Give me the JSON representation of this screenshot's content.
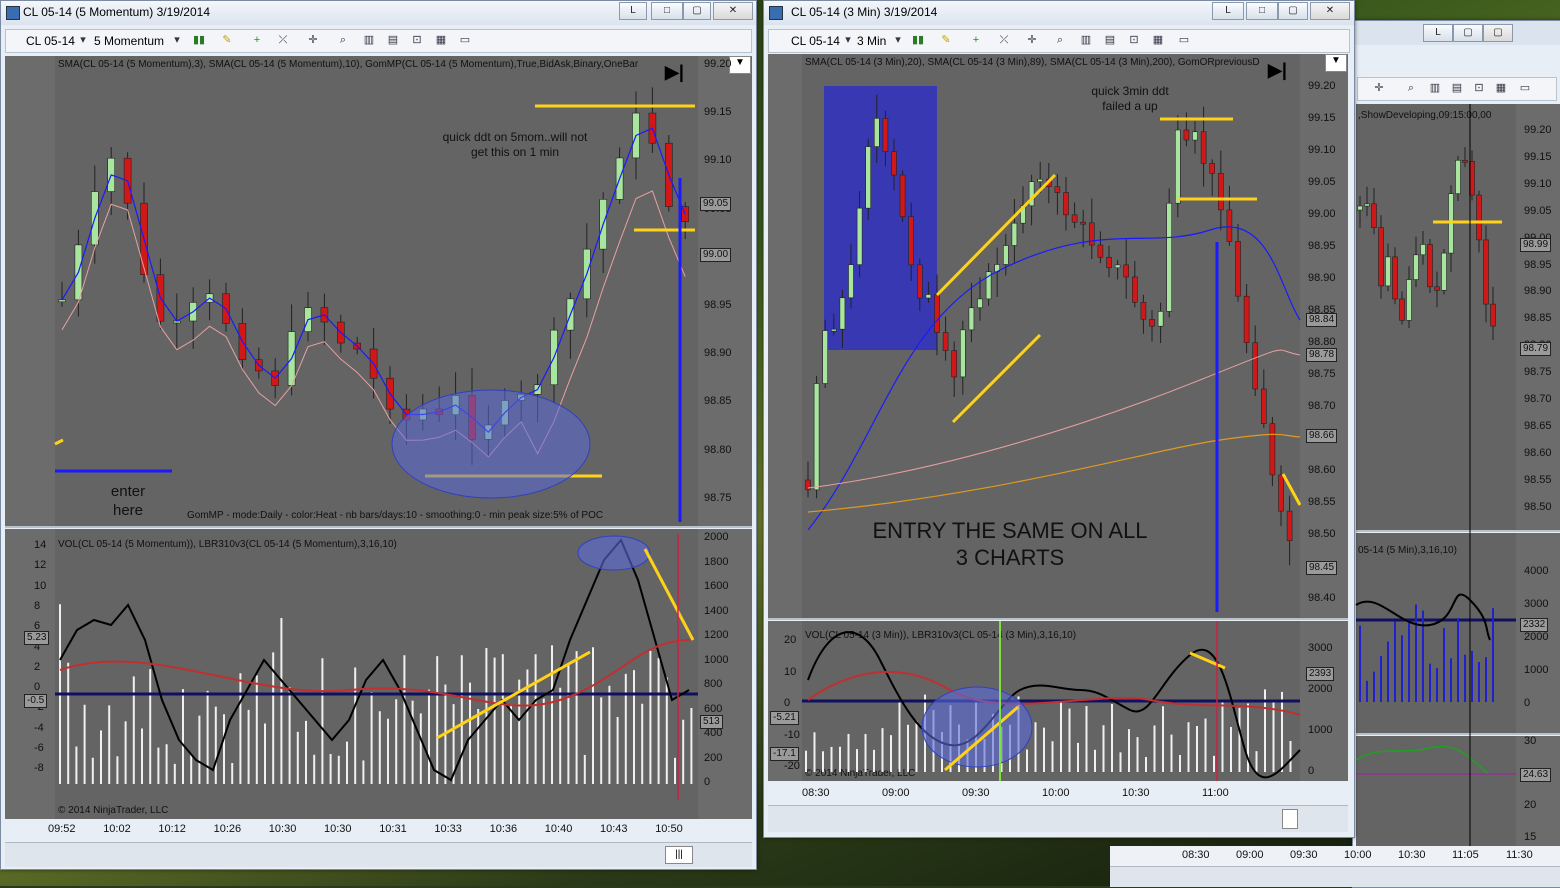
{
  "win1": {
    "title": "CL 05-14 (5 Momentum)  3/19/2014",
    "toolbar": {
      "instrument": "CL 05-14",
      "interval": "5 Momentum"
    },
    "indicators_label": "SMA(CL 05-14 (5 Momentum),3), SMA(CL 05-14 (5 Momentum),10), GomMP(CL 05-14 (5 Momentum),True,BidAsk,Binary,OneBar",
    "gom_label": "GomMP - mode:Daily  - color:Heat - nb bars/days:10 - smoothing:0 - min peak size:5% of POC",
    "lower_label": "VOL(CL 05-14 (5 Momentum)), LBR310v3(CL 05-14 (5 Momentum),3,16,10)",
    "copyright": "© 2014 NinjaTrader, LLC",
    "annotation_1": "quick ddt on 5mom..will not",
    "annotation_2": "get this on 1 min",
    "enter_1": "enter",
    "enter_2": "here",
    "price_ticks": [
      "99.20",
      "99.15",
      "99.10",
      "99.05",
      "99.00",
      "98.95",
      "98.90",
      "98.85",
      "98.80",
      "98.75"
    ],
    "price_box_1": "99.05",
    "price_box_2": "99.00",
    "osc_ticks": [
      "14",
      "12",
      "10",
      "8",
      "6",
      "4",
      "2",
      "0",
      "-2",
      "-4",
      "-6",
      "-8"
    ],
    "osc_box_1": "5.23",
    "osc_box_2": "-0.5",
    "vol_ticks": [
      "2000",
      "1800",
      "1600",
      "1400",
      "1200",
      "1000",
      "800",
      "600",
      "400",
      "200",
      "0"
    ],
    "vol_box": "513",
    "vol_bottom": "0",
    "time_ticks": [
      "09:52",
      "10:02",
      "10:12",
      "10:26",
      "10:30",
      "10:30",
      "10:31",
      "10:33",
      "10:36",
      "10:40",
      "10:43",
      "10:50"
    ]
  },
  "win2": {
    "title": "CL 05-14 (3 Min)  3/19/2014",
    "toolbar": {
      "instrument": "CL 05-14",
      "interval": "3 Min"
    },
    "indicators_label": "SMA(CL 05-14 (3 Min),20), SMA(CL 05-14 (3 Min),89), SMA(CL 05-14 (3 Min),200), GomORpreviousD",
    "lower_label": "VOL(CL 05-14 (3 Min)), LBR310v3(CL 05-14 (3 Min),3,16,10)",
    "copyright": "© 2014 NinjaTrader, LLC",
    "annotation_1": "quick 3min ddt",
    "annotation_2": "failed a up",
    "entry_1": "ENTRY THE SAME ON ALL",
    "entry_2": "3 CHARTS",
    "price_ticks": [
      "99.20",
      "99.15",
      "99.10",
      "99.05",
      "99.00",
      "98.95",
      "98.90",
      "98.85",
      "98.80",
      "98.75",
      "98.70",
      "98.65",
      "98.60",
      "98.55",
      "98.50",
      "98.45",
      "98.40"
    ],
    "price_box_1": "98.84",
    "price_box_2": "98.78",
    "price_box_3": "98.66",
    "price_box_4": "98.45",
    "osc_ticks": [
      "20",
      "10",
      "0",
      "-10",
      "-20"
    ],
    "osc_box_1": "-5.21",
    "osc_box_2": "-17.1",
    "vol_ticks": [
      "3000",
      "2000",
      "1000",
      "0"
    ],
    "vol_box": "2393",
    "time_ticks": [
      "08:30",
      "09:00",
      "09:30",
      "10:00",
      "10:30",
      "11:00"
    ]
  },
  "win3": {
    "indicators_label": ",ShowDeveloping,09:15:00,00",
    "lower_label": "05-14 (5 Min),3,16,10)",
    "price_ticks": [
      "99.20",
      "99.15",
      "99.10",
      "99.05",
      "99.00",
      "98.95",
      "98.90",
      "98.85",
      "98.80",
      "98.75",
      "98.70",
      "98.65",
      "98.60",
      "98.55",
      "98.50"
    ],
    "price_box_1": "98.99",
    "price_box_2": "98.79",
    "vol_ticks": [
      "4000",
      "3000",
      "2000",
      "1000",
      "0"
    ],
    "vol_box": "2332",
    "ind_ticks": [
      "30",
      "25",
      "20",
      "15"
    ],
    "ind_box": "24.63",
    "time_ticks": [
      "08:30",
      "09:00",
      "09:30",
      "10:00",
      "10:30",
      "11:05",
      "11:30"
    ]
  },
  "colors": {
    "up": "#a8e6a0",
    "down": "#d01818",
    "sma_fast": "#1a1aff",
    "sma_slow": "#e8a0a0",
    "yellow": "#ffd21a",
    "ellipse": "#5a6ad8"
  }
}
